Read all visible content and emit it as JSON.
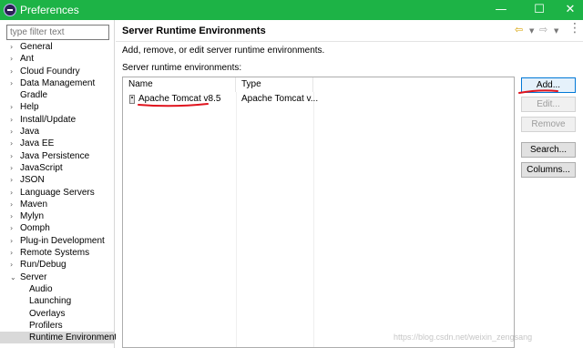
{
  "window": {
    "title": "Preferences",
    "controls": {
      "minimize": "—",
      "maximize": "☐",
      "close": "✕"
    }
  },
  "sidebar": {
    "filter_placeholder": "type filter text",
    "items": [
      {
        "label": "General",
        "expandable": true
      },
      {
        "label": "Ant",
        "expandable": true
      },
      {
        "label": "Cloud Foundry",
        "expandable": true
      },
      {
        "label": "Data Management",
        "expandable": true
      },
      {
        "label": "Gradle",
        "expandable": false
      },
      {
        "label": "Help",
        "expandable": true
      },
      {
        "label": "Install/Update",
        "expandable": true
      },
      {
        "label": "Java",
        "expandable": true
      },
      {
        "label": "Java EE",
        "expandable": true
      },
      {
        "label": "Java Persistence",
        "expandable": true
      },
      {
        "label": "JavaScript",
        "expandable": true
      },
      {
        "label": "JSON",
        "expandable": true
      },
      {
        "label": "Language Servers",
        "expandable": true
      },
      {
        "label": "Maven",
        "expandable": true
      },
      {
        "label": "Mylyn",
        "expandable": true
      },
      {
        "label": "Oomph",
        "expandable": true
      },
      {
        "label": "Plug-in Development",
        "expandable": true
      },
      {
        "label": "Remote Systems",
        "expandable": true
      },
      {
        "label": "Run/Debug",
        "expandable": true
      },
      {
        "label": "Server",
        "expandable": true,
        "expanded": true
      },
      {
        "label": "Audio",
        "child": true
      },
      {
        "label": "Launching",
        "child": true
      },
      {
        "label": "Overlays",
        "child": true
      },
      {
        "label": "Profilers",
        "child": true
      },
      {
        "label": "Runtime Environments",
        "child": true,
        "selected": true
      }
    ]
  },
  "page": {
    "title": "Server Runtime Environments",
    "description": "Add, remove, or edit server runtime environments.",
    "list_label": "Server runtime environments:",
    "nav": {
      "back_icon": "back-arrow-icon",
      "forward_icon": "forward-arrow-icon",
      "menu_icon": "view-menu-icon"
    }
  },
  "table": {
    "columns": [
      "Name",
      "Type"
    ],
    "rows": [
      {
        "name": "Apache Tomcat v8.5",
        "type": "Apache Tomcat v..."
      }
    ]
  },
  "buttons": {
    "add": "Add...",
    "edit": "Edit...",
    "remove": "Remove",
    "search": "Search...",
    "columns": "Columns..."
  },
  "annotations": {
    "underline_color": "#e0141e"
  },
  "watermark": "https://blog.csdn.net/weixin_zengsang",
  "colors": {
    "titlebar": "#1db346",
    "selection": "#d9d9d9",
    "accent": "#0078d7"
  }
}
